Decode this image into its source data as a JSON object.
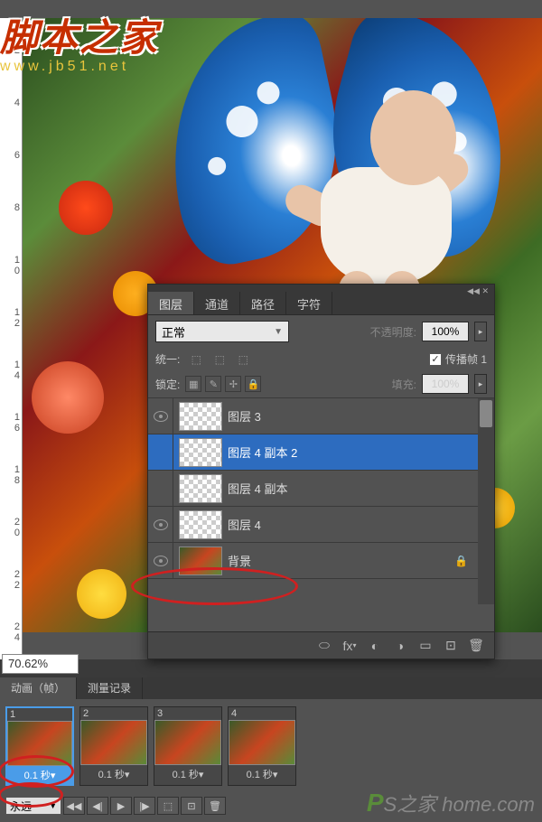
{
  "watermark": {
    "title": "脚本之家",
    "url": "www.jb51.net",
    "bottom_p": "P",
    "bottom_rest": "S之家 home.com"
  },
  "ruler": {
    "ticks": [
      "2",
      "4",
      "6",
      "8",
      "1\n0",
      "1\n2",
      "1\n4",
      "1\n6",
      "1\n8",
      "2\n0",
      "2\n2",
      "2\n4"
    ]
  },
  "zoom": "70.62%",
  "layers_panel": {
    "tabs": [
      "图层",
      "通道",
      "路径",
      "字符"
    ],
    "blend_mode": "正常",
    "opacity_label": "不透明度:",
    "opacity_value": "100%",
    "unify_label": "统一:",
    "propagate_label": "传播帧 1",
    "lock_label": "锁定:",
    "fill_label": "填充:",
    "fill_value": "100%",
    "layers": [
      {
        "name": "图层 3",
        "visible": true,
        "thumb": "checker",
        "selected": false
      },
      {
        "name": "图层 4 副本 2",
        "visible": false,
        "thumb": "checker",
        "selected": true
      },
      {
        "name": "图层 4 副本",
        "visible": false,
        "thumb": "checker",
        "selected": false
      },
      {
        "name": "图层 4",
        "visible": true,
        "thumb": "checker",
        "selected": false
      },
      {
        "name": "背景",
        "visible": true,
        "thumb": "bg",
        "selected": false,
        "locked": true
      }
    ]
  },
  "animation": {
    "tabs": [
      "动画（帧）",
      "测量记录"
    ],
    "frames": [
      {
        "num": "1",
        "delay": "0.1 秒▾",
        "selected": true
      },
      {
        "num": "2",
        "delay": "0.1 秒▾",
        "selected": false
      },
      {
        "num": "3",
        "delay": "0.1 秒▾",
        "selected": false
      },
      {
        "num": "4",
        "delay": "0.1 秒▾",
        "selected": false
      }
    ],
    "loop": "永远"
  }
}
